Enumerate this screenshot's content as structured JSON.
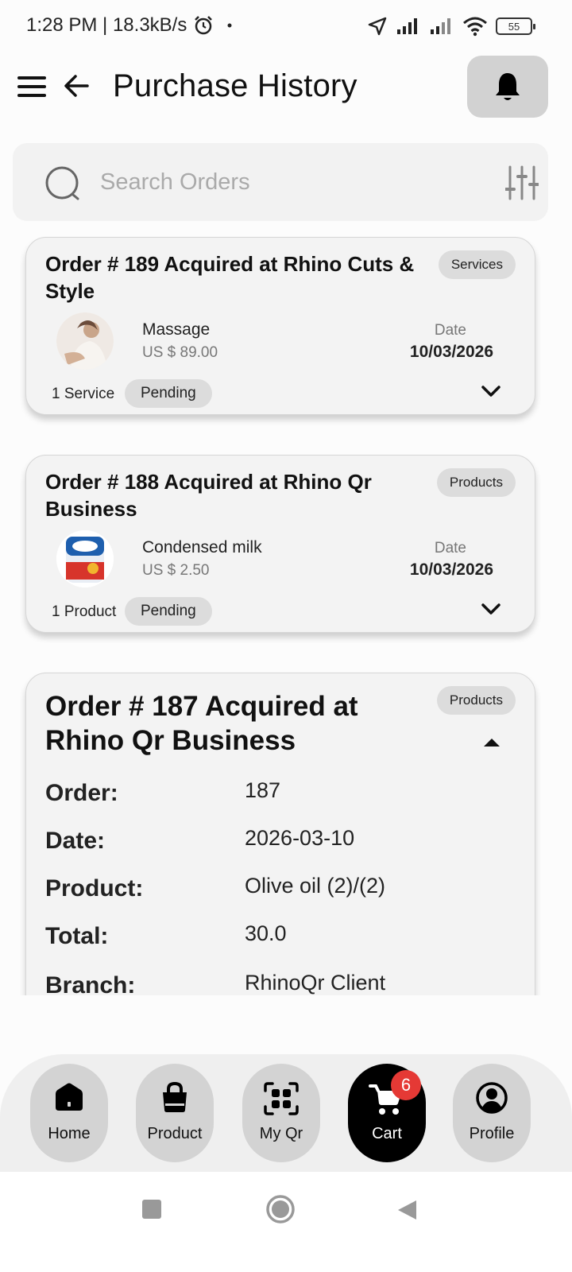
{
  "status_bar": {
    "time_speed": "1:28 PM | 18.3kB/s",
    "battery": "55"
  },
  "header": {
    "title": "Purchase History"
  },
  "search": {
    "placeholder": "Search Orders"
  },
  "orders": [
    {
      "title": "Order # 189 Acquired at Rhino Cuts & Style",
      "category": "Services",
      "item_name": "Massage",
      "item_price": "US $ 89.00",
      "date_label": "Date",
      "date": "10/03/2026",
      "count": "1 Service",
      "status": "Pending"
    },
    {
      "title": "Order # 188 Acquired at Rhino Qr Business",
      "category": "Products",
      "item_name": "Condensed milk",
      "item_price": "US $ 2.50",
      "date_label": "Date",
      "date": "10/03/2026",
      "count": "1 Product",
      "status": "Pending"
    },
    {
      "title": "Order # 187 Acquired at Rhino Qr Business",
      "category": "Products",
      "details": [
        {
          "key": "Order:",
          "value": "187"
        },
        {
          "key": "Date:",
          "value": "2026-03-10"
        },
        {
          "key": "Product:",
          "value": "Olive oil (2)/(2)"
        },
        {
          "key": "Total:",
          "value": "30.0"
        },
        {
          "key": "Branch:",
          "value": "RhinoQr Client"
        }
      ]
    }
  ],
  "bottom_nav": {
    "items": [
      {
        "label": "Home",
        "icon": "home-icon"
      },
      {
        "label": "Product",
        "icon": "bag-icon"
      },
      {
        "label": "My Qr",
        "icon": "qr-icon"
      },
      {
        "label": "Cart",
        "icon": "cart-icon",
        "badge": "6",
        "active": true
      },
      {
        "label": "Profile",
        "icon": "profile-icon"
      }
    ]
  },
  "colors": {
    "card_bg": "#f3f3f3",
    "pill_bg": "#dcdcdc",
    "active_nav": "#000000",
    "badge": "#e53935"
  }
}
